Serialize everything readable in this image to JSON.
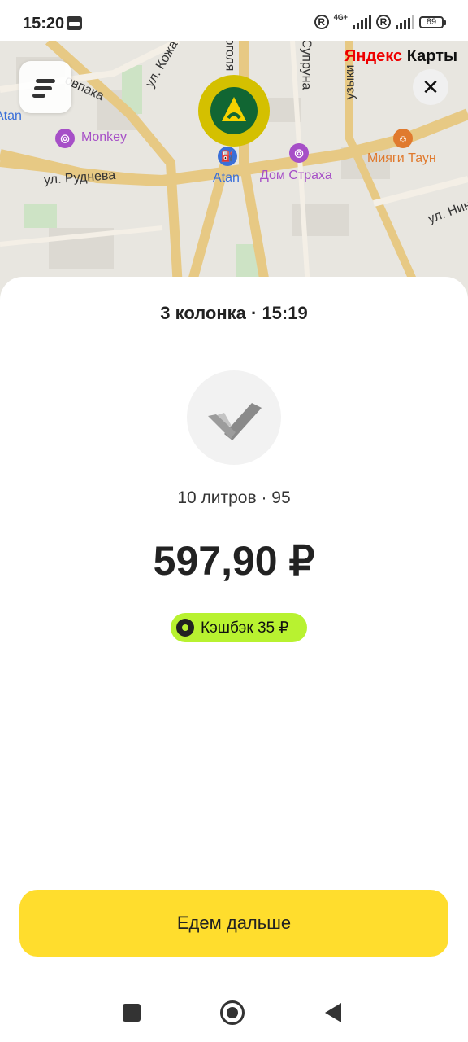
{
  "status_bar": {
    "time": "15:20",
    "network_label": "4G+",
    "battery": "89"
  },
  "map": {
    "brand_prefix": "Яндекс",
    "brand_suffix": " Карты",
    "street_labels": [
      "ул. Руднева",
      "овпака",
      "ул. Кожа",
      "оголя",
      "Супруна",
      "узыки",
      "ул. Нин"
    ],
    "pois": [
      {
        "name": "Monkey",
        "color": "#a64fc7"
      },
      {
        "name": "Atan",
        "color": "#3a6fd8"
      },
      {
        "name": "Дом Страха",
        "color": "#a64fc7"
      },
      {
        "name": "Мияги Таун",
        "color": "#e07a2e"
      },
      {
        "name": "Atan",
        "color": "#3a6fd8"
      }
    ]
  },
  "sheet": {
    "title": "3 колонка · 15:19",
    "fuel_info": "10 литров · 95",
    "price": "597,90 ₽",
    "cashback": "Кэшбэк 35 ₽",
    "primary_button": "Едем дальше"
  },
  "colors": {
    "accent_yellow": "#ffdd2d",
    "cashback_green": "#b8f230",
    "station_green": "#116633"
  },
  "icons": [
    "menu-icon",
    "close-icon",
    "check-icon",
    "cashback-icon",
    "station-icon"
  ]
}
